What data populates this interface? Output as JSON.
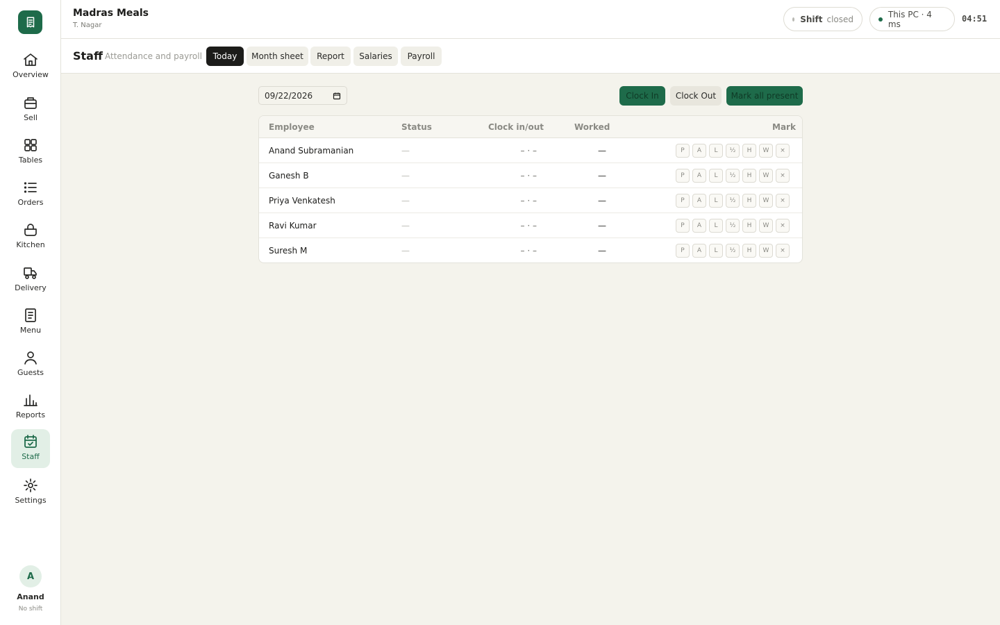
{
  "sidebar": {
    "logo_icon": "receipt-icon",
    "items": [
      {
        "label": "Overview",
        "icon": "home-icon"
      },
      {
        "label": "Sell",
        "icon": "register-icon"
      },
      {
        "label": "Tables",
        "icon": "grid-icon"
      },
      {
        "label": "Orders",
        "icon": "list-icon"
      },
      {
        "label": "Kitchen",
        "icon": "pot-icon"
      },
      {
        "label": "Delivery",
        "icon": "scooter-icon"
      },
      {
        "label": "Menu",
        "icon": "menu-icon"
      },
      {
        "label": "Guests",
        "icon": "user-icon"
      },
      {
        "label": "Reports",
        "icon": "bar-chart-icon"
      },
      {
        "label": "Staff",
        "icon": "calendar-check-icon",
        "active": true
      },
      {
        "label": "Settings",
        "icon": "gear-icon"
      }
    ],
    "user": {
      "initial": "A",
      "name": "Anand",
      "status": "No shift"
    }
  },
  "header": {
    "brand": "Madras Meals",
    "branch": "T. Nagar",
    "shift": {
      "label": "Shift",
      "value": "closed"
    },
    "connection": "This PC · 4 ms",
    "time": "04:51"
  },
  "subheader": {
    "title": "Staff",
    "subtitle": "Attendance and payroll",
    "tabs": [
      {
        "label": "Today",
        "active": true
      },
      {
        "label": "Month sheet"
      },
      {
        "label": "Report"
      },
      {
        "label": "Salaries"
      },
      {
        "label": "Payroll"
      }
    ]
  },
  "toolbar": {
    "date": "09/22/2026",
    "clock_in": "Clock In",
    "clock_out": "Clock Out",
    "mark_all": "Mark all present"
  },
  "table": {
    "headers": {
      "employee": "Employee",
      "status": "Status",
      "clock": "Clock in/out",
      "worked": "Worked",
      "mark": "Mark"
    },
    "marks": [
      "P",
      "A",
      "L",
      "½",
      "H",
      "W",
      "×"
    ],
    "rows": [
      {
        "name": "Anand Subramanian",
        "status": "—",
        "clock": "– · –",
        "worked": "—"
      },
      {
        "name": "Ganesh B",
        "status": "—",
        "clock": "– · –",
        "worked": "—"
      },
      {
        "name": "Priya Venkatesh",
        "status": "—",
        "clock": "– · –",
        "worked": "—"
      },
      {
        "name": "Ravi Kumar",
        "status": "—",
        "clock": "– · –",
        "worked": "—"
      },
      {
        "name": "Suresh M",
        "status": "—",
        "clock": "– · –",
        "worked": "—"
      }
    ]
  },
  "colors": {
    "accent": "#1e6b4a",
    "active_bg": "#e2efe6",
    "canvas": "#f4f3ec"
  }
}
